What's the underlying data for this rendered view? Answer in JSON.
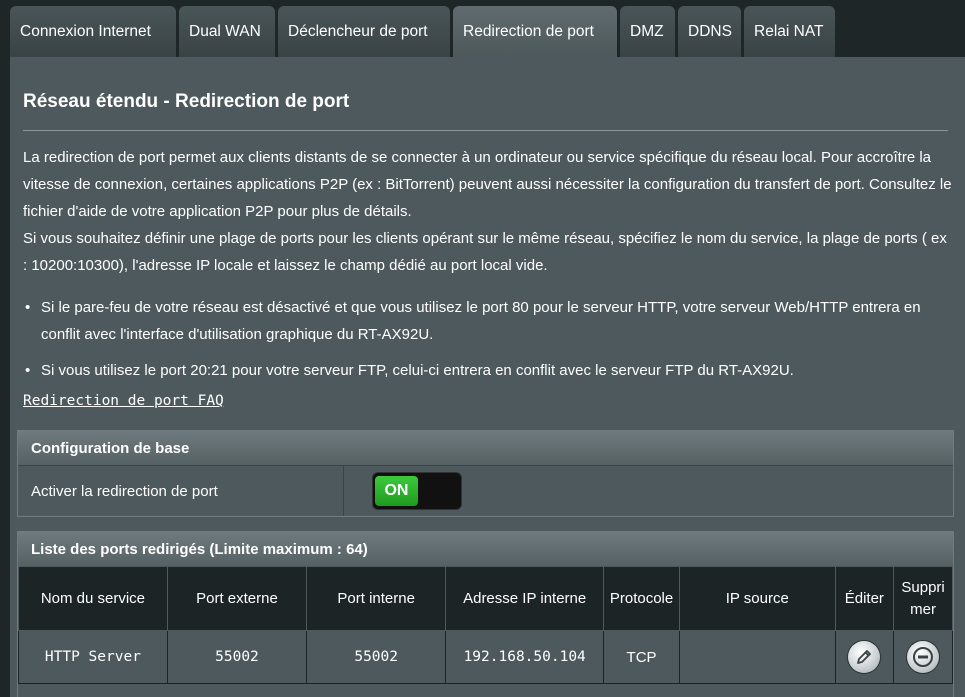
{
  "tabs": [
    {
      "label": "Connexion Internet"
    },
    {
      "label": "Dual WAN"
    },
    {
      "label": "Déclencheur de port"
    },
    {
      "label": "Redirection de port"
    },
    {
      "label": "DMZ"
    },
    {
      "label": "DDNS"
    },
    {
      "label": "Relai NAT"
    }
  ],
  "active_tab": "Redirection de port",
  "page": {
    "title": "Réseau étendu - Redirection de port",
    "description": [
      "La redirection de port permet aux clients distants de se connecter à un ordinateur ou service spécifique du réseau local. Pour accroître la vitesse de connexion, certaines applications P2P (ex : BitTorrent) peuvent aussi nécessiter la configuration du transfert de port. Consultez le fichier d'aide de votre application P2P pour plus de détails.",
      "Si vous souhaitez définir une plage de ports pour les clients opérant sur le même réseau, spécifiez le nom du service, la plage de ports ( ex : 10200:10300), l'adresse IP locale et laissez le champ dédié au port local vide."
    ],
    "bullets": [
      "Si le pare-feu de votre réseau est désactivé et que vous utilisez le port 80 pour le serveur HTTP, votre serveur Web/HTTP entrera en conflit avec l'interface d'utilisation graphique du RT-AX92U.",
      "Si vous utilisez le port 20:21 pour votre serveur FTP, celui-ci entrera en conflit avec le serveur FTP du RT-AX92U."
    ],
    "faq_link": "Redirection de port FAQ"
  },
  "basic_config": {
    "header": "Configuration de base",
    "enable_label": "Activer la redirection de port",
    "toggle_state": "ON"
  },
  "port_list": {
    "header": "Liste des ports redirigés (Limite maximum : 64)",
    "columns": [
      "Nom du service",
      "Port externe",
      "Port interne",
      "Adresse IP interne",
      "Protocole",
      "IP source",
      "Éditer",
      "Suppri mer"
    ],
    "rows": [
      {
        "service": "HTTP Server",
        "external_port": "55002",
        "internal_port": "55002",
        "internal_ip": "192.168.50.104",
        "protocol": "TCP",
        "source_ip": "",
        "edit_icon": "pencil-icon",
        "delete_icon": "minus-circle-icon"
      }
    ]
  },
  "colors": {
    "background": "#1e2628",
    "panel": "#4d595d",
    "toggle_on": "#2fb52f"
  }
}
